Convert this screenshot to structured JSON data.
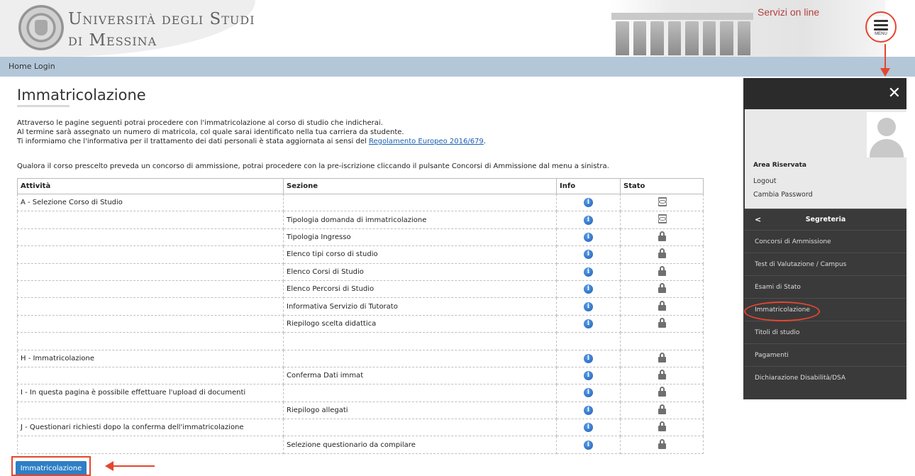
{
  "header": {
    "uni_name_line1": "Università degli Studi",
    "uni_name_line2": "di Messina",
    "servizi": "Servizi on line",
    "menu_label": "MENU"
  },
  "nav": {
    "home": "Home",
    "login": "Login"
  },
  "page": {
    "title": "Immatricolazione",
    "intro_line1": "Attraverso le pagine seguenti potrai procedere con l'immatricolazione al corso di studio che indicherai.",
    "intro_line2": "Al termine sarà assegnato un numero di matricola, col quale sarai identificato nella tua carriera da studente.",
    "intro_line3_pre": "Ti informiamo che l'informativa per il trattamento dei dati personali è stata aggiornata ai sensi del ",
    "intro_line3_link": "Regolamento Europeo 2016/679",
    "intro_line3_post": ".",
    "note": "Qualora il corso prescelto preveda un concorso di ammissione, potrai procedere con la pre-iscrizione cliccando il pulsante Concorsi di Ammissione dal menu a sinistra."
  },
  "table": {
    "headers": {
      "attivita": "Attività",
      "sezione": "Sezione",
      "info": "Info",
      "stato": "Stato"
    },
    "rows": [
      {
        "attivita": "A - Selezione Corso di Studio",
        "sezione": "",
        "info": true,
        "stato": "hourglass"
      },
      {
        "attivita": "",
        "sezione": "Tipologia domanda di immatricolazione",
        "info": true,
        "stato": "hourglass"
      },
      {
        "attivita": "",
        "sezione": "Tipologia Ingresso",
        "info": true,
        "stato": "lock"
      },
      {
        "attivita": "",
        "sezione": "Elenco tipi corso di studio",
        "info": true,
        "stato": "lock"
      },
      {
        "attivita": "",
        "sezione": "Elenco Corsi di Studio",
        "info": true,
        "stato": "lock"
      },
      {
        "attivita": "",
        "sezione": "Elenco Percorsi di Studio",
        "info": true,
        "stato": "lock"
      },
      {
        "attivita": "",
        "sezione": "Informativa Servizio di Tutorato",
        "info": true,
        "stato": "lock"
      },
      {
        "attivita": "",
        "sezione": "Riepilogo scelta didattica",
        "info": true,
        "stato": "lock"
      },
      {
        "attivita": "",
        "sezione": "",
        "info": false,
        "stato": ""
      },
      {
        "attivita": "H - Immatricolazione",
        "sezione": "",
        "info": true,
        "stato": "lock"
      },
      {
        "attivita": "",
        "sezione": "Conferma Dati immat",
        "info": true,
        "stato": "lock"
      },
      {
        "attivita": "I - In questa pagina è possibile effettuare l'upload di documenti",
        "sezione": "",
        "info": true,
        "stato": "lock"
      },
      {
        "attivita": "",
        "sezione": "Riepilogo allegati",
        "info": true,
        "stato": "lock"
      },
      {
        "attivita": "J - Questionari richiesti dopo la conferma dell'immatricolazione",
        "sezione": "",
        "info": true,
        "stato": "lock"
      },
      {
        "attivita": "",
        "sezione": "Selezione questionario da compilare",
        "info": true,
        "stato": "lock"
      }
    ]
  },
  "button": {
    "label": "Immatricolazione"
  },
  "side_menu": {
    "area_title": "Area Riservata",
    "logout": "Logout",
    "change_password": "Cambia Password",
    "section_title": "Segreteria",
    "items": [
      "Concorsi di Ammissione",
      "Test di Valutazione / Campus",
      "Esami di Stato",
      "Immatricolazione",
      "Titoli di studio",
      "Pagamenti",
      "Dichiarazione Disabilità/DSA"
    ]
  },
  "colors": {
    "accent_red": "#e5452f",
    "nav_bar": "#b3c7d9",
    "button_blue": "#2d7fc6",
    "menu_dark": "#3a3a3a"
  }
}
